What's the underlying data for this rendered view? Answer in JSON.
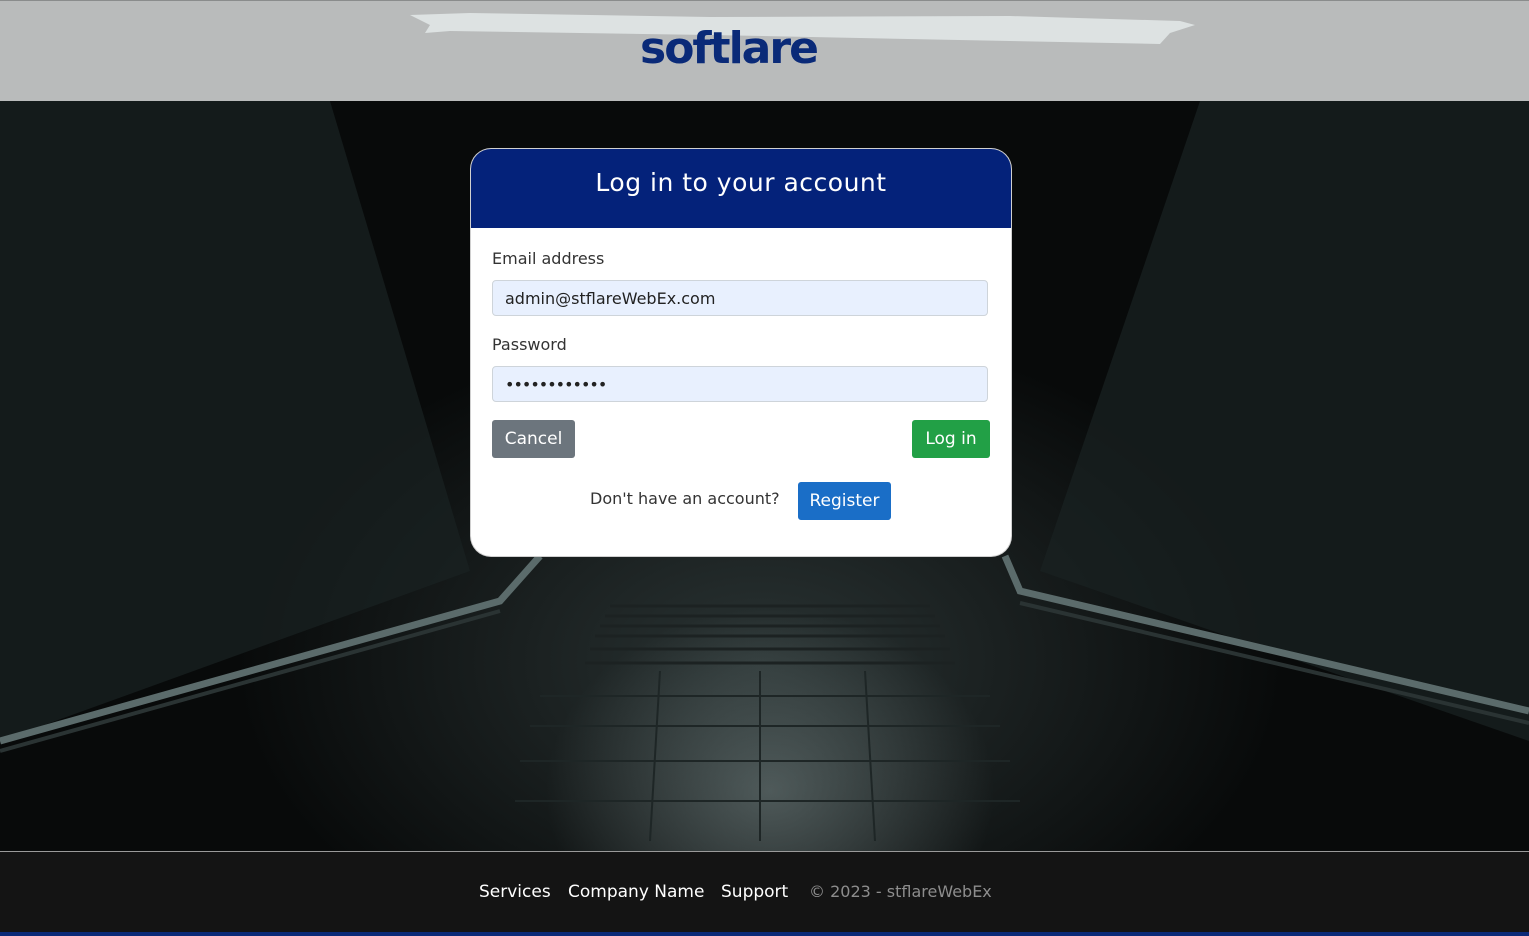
{
  "header": {
    "logo_text": "softlare"
  },
  "login": {
    "title": "Log in to your account",
    "email_label": "Email address",
    "email_value": "admin@stflareWebEx.com",
    "password_label": "Password",
    "password_value": "••••••••••••",
    "cancel_label": "Cancel",
    "login_label": "Log in",
    "register_prompt": "Don't have an account?",
    "register_label": "Register"
  },
  "footer": {
    "links": [
      "Services",
      "Company Name",
      "Support"
    ],
    "copyright": "© 2023 - stflareWebEx"
  },
  "colors": {
    "brand_blue": "#04227a",
    "login_green": "#22a046",
    "register_blue": "#1a6ec7",
    "cancel_gray": "#6c757d"
  }
}
